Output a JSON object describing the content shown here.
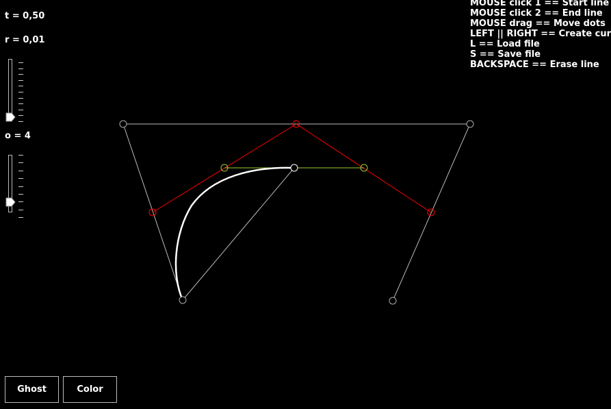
{
  "params": {
    "t_label": "t = 0,50",
    "r_label": "r = 0,01",
    "o_label": "o = 4"
  },
  "sliders": {
    "r_level": 0.0,
    "o_level": 0.25
  },
  "help_lines": [
    "MOUSE click 1 == Start line",
    "MOUSE click 2 == End line",
    "MOUSE drag == Move dots",
    "LEFT || RIGHT == Create curve",
    "L == Load file",
    "S == Save file",
    "BACKSPACE == Erase line"
  ],
  "buttons": {
    "ghost": "Ghost",
    "color": "Color"
  },
  "colors": {
    "background": "#000000",
    "control_polygon": "#bbbbbb",
    "level1": "#ff0000",
    "level2": "#9acd32",
    "curve": "#ffffff"
  }
}
